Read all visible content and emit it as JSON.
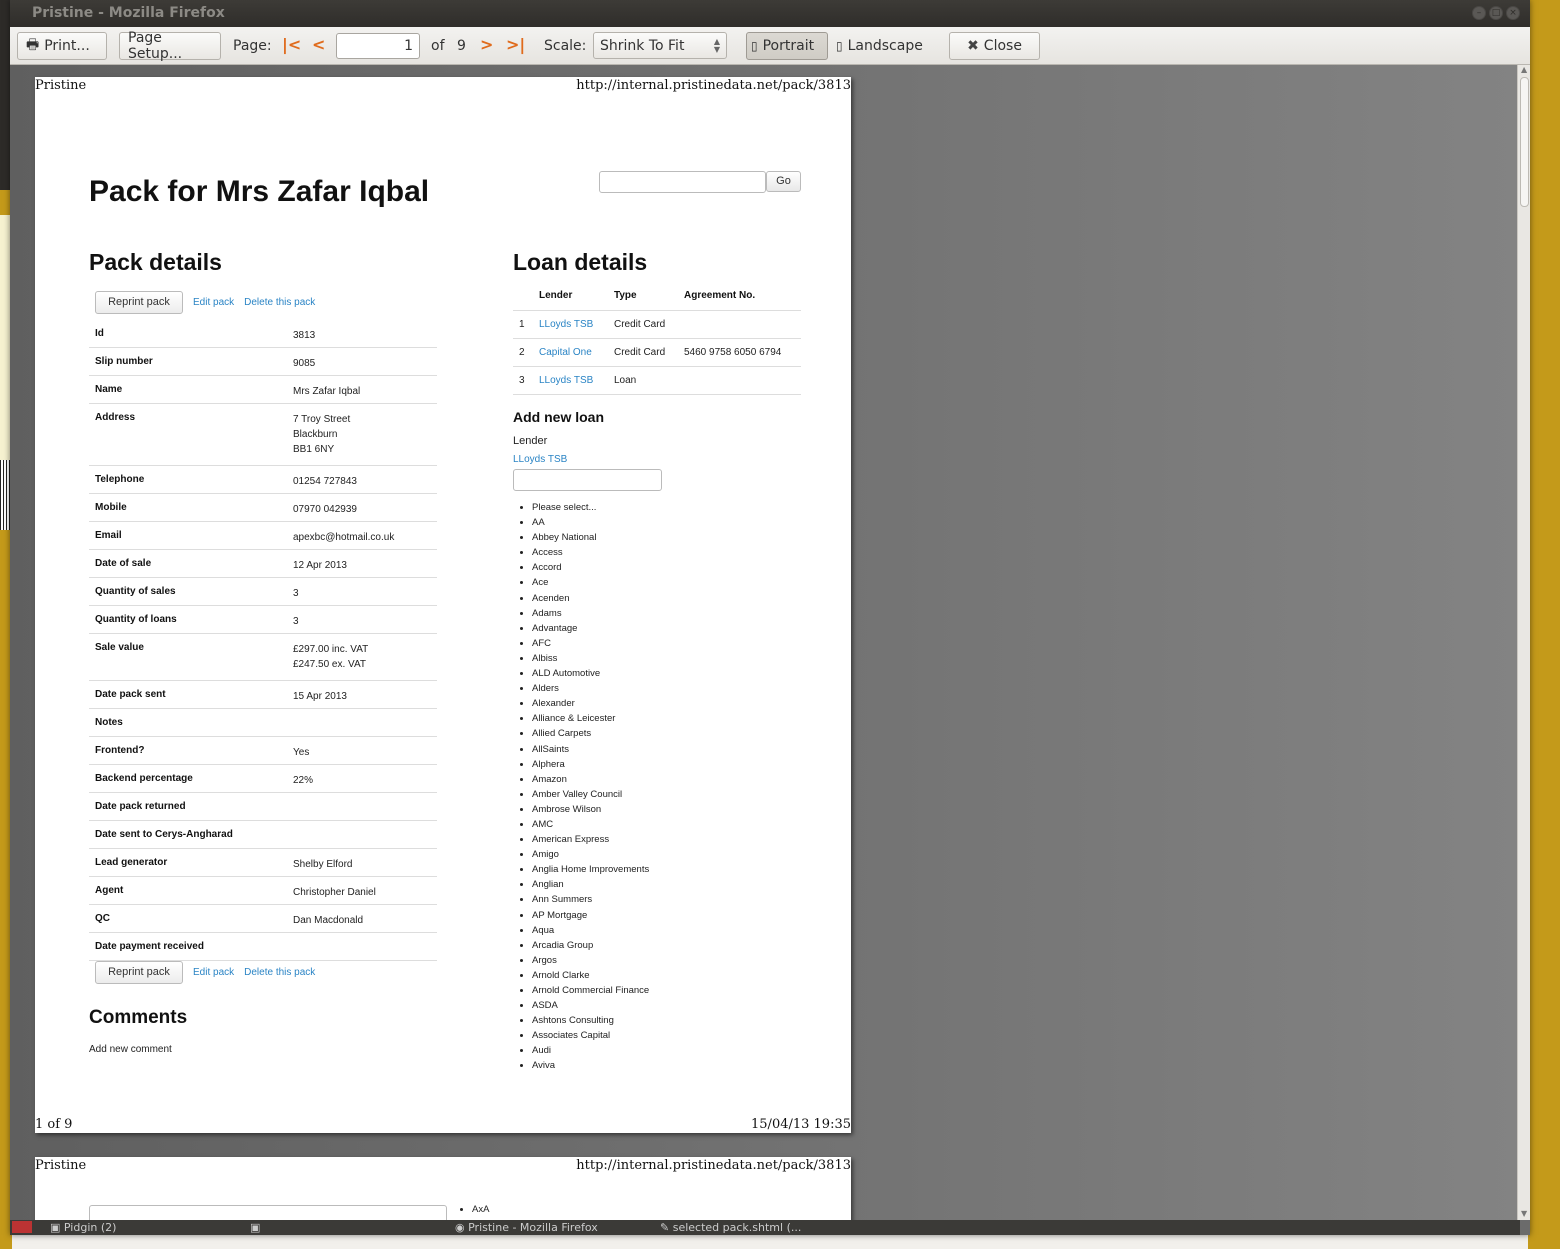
{
  "window": {
    "title": "Pristine - Mozilla Firefox"
  },
  "toolbar": {
    "print_label": "Print...",
    "page_setup_label": "Page Setup...",
    "page_label": "Page:",
    "current_page": "1",
    "of_label": "of",
    "total_pages": "9",
    "scale_label": "Scale:",
    "scale_value": "Shrink To Fit",
    "portrait_label": "Portrait",
    "landscape_label": "Landscape",
    "close_label": "Close"
  },
  "page_header": {
    "left": "Pristine",
    "right": "http://internal.pristinedata.net/pack/3813"
  },
  "page_footer": {
    "left": "1 of 9",
    "right": "15/04/13 19:35"
  },
  "page": {
    "title": "Pack for Mrs Zafar Iqbal",
    "go_label": "Go",
    "pack_details_heading": "Pack details",
    "reprint_label": "Reprint pack",
    "edit_label": "Edit pack",
    "delete_label": "Delete this pack",
    "details": [
      {
        "key": "Id",
        "value": "3813"
      },
      {
        "key": "Slip number",
        "value": "9085"
      },
      {
        "key": "Name",
        "value": "Mrs Zafar Iqbal"
      },
      {
        "key": "Address",
        "lines": [
          "7 Troy Street",
          "Blackburn",
          "BB1 6NY"
        ]
      },
      {
        "key": "Telephone",
        "value": "01254 727843"
      },
      {
        "key": "Mobile",
        "value": "07970 042939"
      },
      {
        "key": "Email",
        "value": "apexbc@hotmail.co.uk"
      },
      {
        "key": "Date of sale",
        "value": "12 Apr 2013"
      },
      {
        "key": "Quantity of sales",
        "value": "3"
      },
      {
        "key": "Quantity of loans",
        "value": "3"
      },
      {
        "key": "Sale value",
        "lines": [
          "£297.00 inc. VAT",
          "£247.50 ex. VAT"
        ]
      },
      {
        "key": "Date pack sent",
        "value": "15 Apr 2013"
      },
      {
        "key": "Notes",
        "value": ""
      },
      {
        "key": "Frontend?",
        "value": "Yes"
      },
      {
        "key": "Backend percentage",
        "value": "22%"
      },
      {
        "key": "Date pack returned",
        "value": ""
      },
      {
        "key": "Date sent to Cerys-Angharad",
        "value": ""
      },
      {
        "key": "Lead generator",
        "value": "Shelby Elford"
      },
      {
        "key": "Agent",
        "value": "Christopher Daniel"
      },
      {
        "key": "QC",
        "value": "Dan Macdonald"
      },
      {
        "key": "Date payment received",
        "value": ""
      }
    ],
    "comments_heading": "Comments",
    "add_comment_label": "Add new comment",
    "loan_details_heading": "Loan details",
    "loan_columns": [
      "",
      "Lender",
      "Type",
      "Agreement No."
    ],
    "loans": [
      {
        "n": "1",
        "lender": "LLoyds TSB",
        "type": "Credit Card",
        "agreement": ""
      },
      {
        "n": "2",
        "lender": "Capital One",
        "type": "Credit Card",
        "agreement": "5460 9758 6050 6794"
      },
      {
        "n": "3",
        "lender": "LLoyds TSB",
        "type": "Loan",
        "agreement": ""
      }
    ],
    "add_loan_heading": "Add new loan",
    "lender_label": "Lender",
    "selected_lender": "LLoyds TSB",
    "lender_options": [
      "Please select...",
      "AA",
      "Abbey National",
      "Access",
      "Accord",
      "Ace",
      "Acenden",
      "Adams",
      "Advantage",
      "AFC",
      "Albiss",
      "ALD Automotive",
      "Alders",
      "Alexander",
      "Alliance & Leicester",
      "Allied Carpets",
      "AllSaints",
      "Alphera",
      "Amazon",
      "Amber Valley Council",
      "Ambrose Wilson",
      "AMC",
      "American Express",
      "Amigo",
      "Anglia Home Improvements",
      "Anglian",
      "Ann Summers",
      "AP Mortgage",
      "Aqua",
      "Arcadia Group",
      "Argos",
      "Arnold Clarke",
      "Arnold Commercial Finance",
      "ASDA",
      "Ashtons Consulting",
      "Associates Capital",
      "Audi",
      "Aviva"
    ]
  },
  "page2": {
    "first_option": "AxA"
  },
  "taskbar": {
    "items": [
      "Pidgin (2)",
      "",
      "Pristine - Mozilla Firefox",
      "selected pack.shtml (..."
    ]
  }
}
